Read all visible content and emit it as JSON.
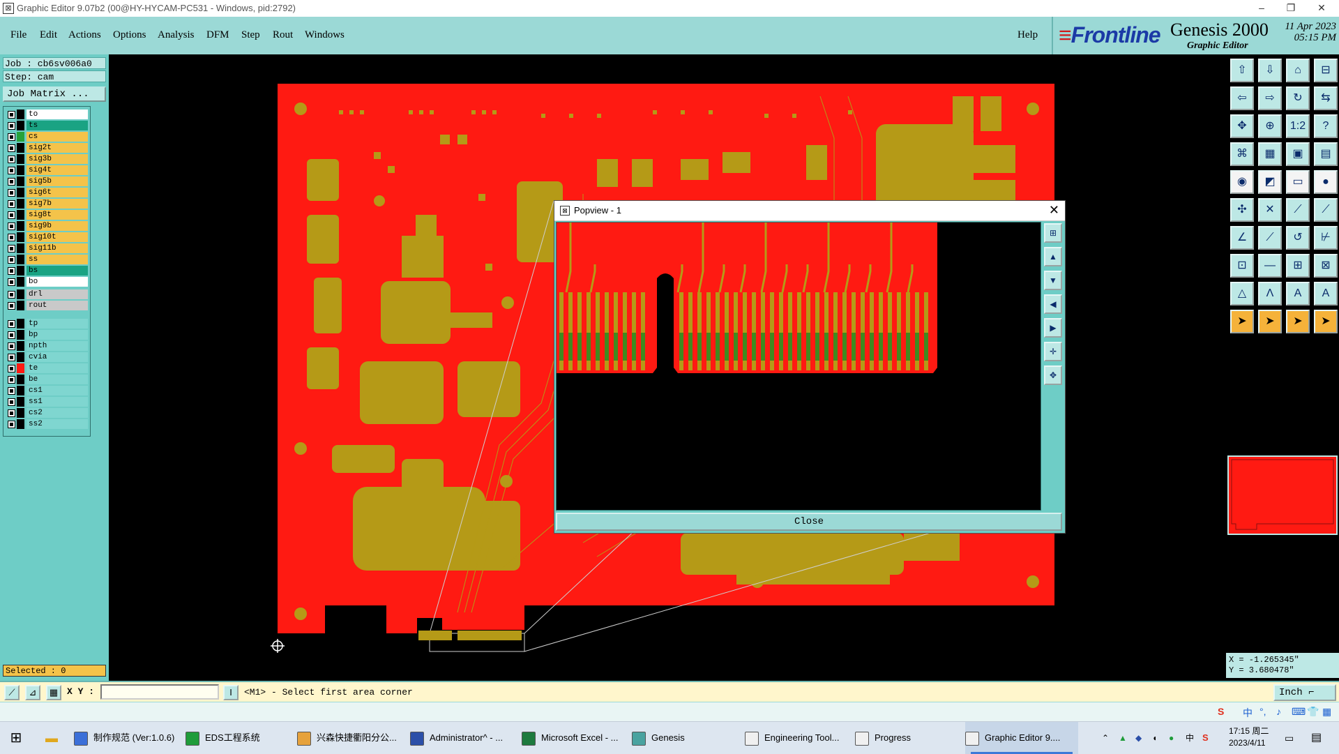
{
  "window": {
    "title": "Graphic Editor 9.07b2 (00@HY-HYCAM-PC531 - Windows, pid:2792)",
    "controls": [
      "–",
      "❐",
      "✕"
    ]
  },
  "menu": {
    "items": [
      "File",
      "Edit",
      "Actions",
      "Options",
      "Analysis",
      "DFM",
      "Step",
      "Rout",
      "Windows"
    ],
    "help": "Help"
  },
  "brand": {
    "logo": "Frontline",
    "product": "Genesis 2000",
    "subtitle": "Graphic Editor",
    "date": "11 Apr 2023",
    "time": "05:15 PM"
  },
  "job": {
    "job_line": "Job : cb6sv006a0",
    "step_line": "Step: cam",
    "matrix_button": "Job Matrix ..."
  },
  "layers": {
    "group1": [
      {
        "name": "to",
        "color": "#ffffff",
        "swatch": "#000000"
      },
      {
        "name": "ts",
        "color": "#1aa383",
        "swatch": "#000000"
      },
      {
        "name": "cs",
        "color": "#f4c34a",
        "swatch": "#27a23a"
      },
      {
        "name": "sig2t",
        "color": "#f4c34a",
        "swatch": "#000000"
      },
      {
        "name": "sig3b",
        "color": "#f4c34a",
        "swatch": "#000000"
      },
      {
        "name": "sig4t",
        "color": "#f4c34a",
        "swatch": "#000000"
      },
      {
        "name": "sig5b",
        "color": "#f4c34a",
        "swatch": "#000000"
      },
      {
        "name": "sig6t",
        "color": "#f4c34a",
        "swatch": "#000000"
      },
      {
        "name": "sig7b",
        "color": "#f4c34a",
        "swatch": "#000000"
      },
      {
        "name": "sig8t",
        "color": "#f4c34a",
        "swatch": "#000000"
      },
      {
        "name": "sig9b",
        "color": "#f4c34a",
        "swatch": "#000000"
      },
      {
        "name": "sig10t",
        "color": "#f4c34a",
        "swatch": "#000000"
      },
      {
        "name": "sig11b",
        "color": "#f4c34a",
        "swatch": "#000000"
      },
      {
        "name": "ss",
        "color": "#f4c34a",
        "swatch": "#000000"
      },
      {
        "name": "bs",
        "color": "#1aa383",
        "swatch": "#000000"
      },
      {
        "name": "bo",
        "color": "#ffffff",
        "swatch": "#000000"
      }
    ],
    "group2": [
      {
        "name": "drl",
        "color": "#c9c9c9",
        "swatch": "#000000"
      },
      {
        "name": "rout",
        "color": "#c9c9c9",
        "swatch": "#000000"
      }
    ],
    "group3": [
      {
        "name": "tp",
        "color": "#7fd6d0",
        "swatch": "#000000"
      },
      {
        "name": "bp",
        "color": "#7fd6d0",
        "swatch": "#000000"
      },
      {
        "name": "npth",
        "color": "#7fd6d0",
        "swatch": "#000000"
      },
      {
        "name": "cvia",
        "color": "#7fd6d0",
        "swatch": "#000000"
      },
      {
        "name": "te",
        "color": "#7fd6d0",
        "swatch": "#ff1a12"
      },
      {
        "name": "be",
        "color": "#7fd6d0",
        "swatch": "#000000"
      },
      {
        "name": "cs1",
        "color": "#7fd6d0",
        "swatch": "#000000"
      },
      {
        "name": "ss1",
        "color": "#7fd6d0",
        "swatch": "#000000"
      },
      {
        "name": "cs2",
        "color": "#7fd6d0",
        "swatch": "#000000"
      },
      {
        "name": "ss2",
        "color": "#7fd6d0",
        "swatch": "#000000"
      }
    ],
    "selected": "Selected : 0"
  },
  "popview": {
    "title": "Popview - 1",
    "close": "Close"
  },
  "coords": {
    "x": "X = -1.265345\"",
    "y": "Y = 3.680478\""
  },
  "command": {
    "xy_label": "X Y :",
    "input_value": "",
    "message": "<M1> - Select first area corner",
    "units": "Inch"
  },
  "taskbar": {
    "items": [
      {
        "label": "制作规范 (Ver:1.0.6)",
        "icon_color": "#3b6fd8"
      },
      {
        "label": "EDS工程系统",
        "icon_color": "#1f9c3a"
      },
      {
        "label": "兴森快捷衢阳分公...",
        "icon_color": "#e6a23c"
      },
      {
        "label": "Administrator^ - ...",
        "icon_color": "#2b4fa8"
      },
      {
        "label": "Microsoft Excel - ...",
        "icon_color": "#1d7a3e"
      },
      {
        "label": "Genesis",
        "icon_color": "#4aa3a0"
      },
      {
        "label": "Engineering Tool...",
        "icon_color": "#f0f0f0"
      },
      {
        "label": "Progress",
        "icon_color": "#f0f0f0"
      },
      {
        "label": "Graphic Editor 9....",
        "icon_color": "#f0f0f0"
      }
    ],
    "clock_time": "17:15 周二",
    "clock_date": "2023/4/11"
  },
  "colors": {
    "board": "#ff1a12",
    "copper": "#b59a17",
    "panel": "#6ecdc6",
    "menubar": "#9bd9d6"
  }
}
